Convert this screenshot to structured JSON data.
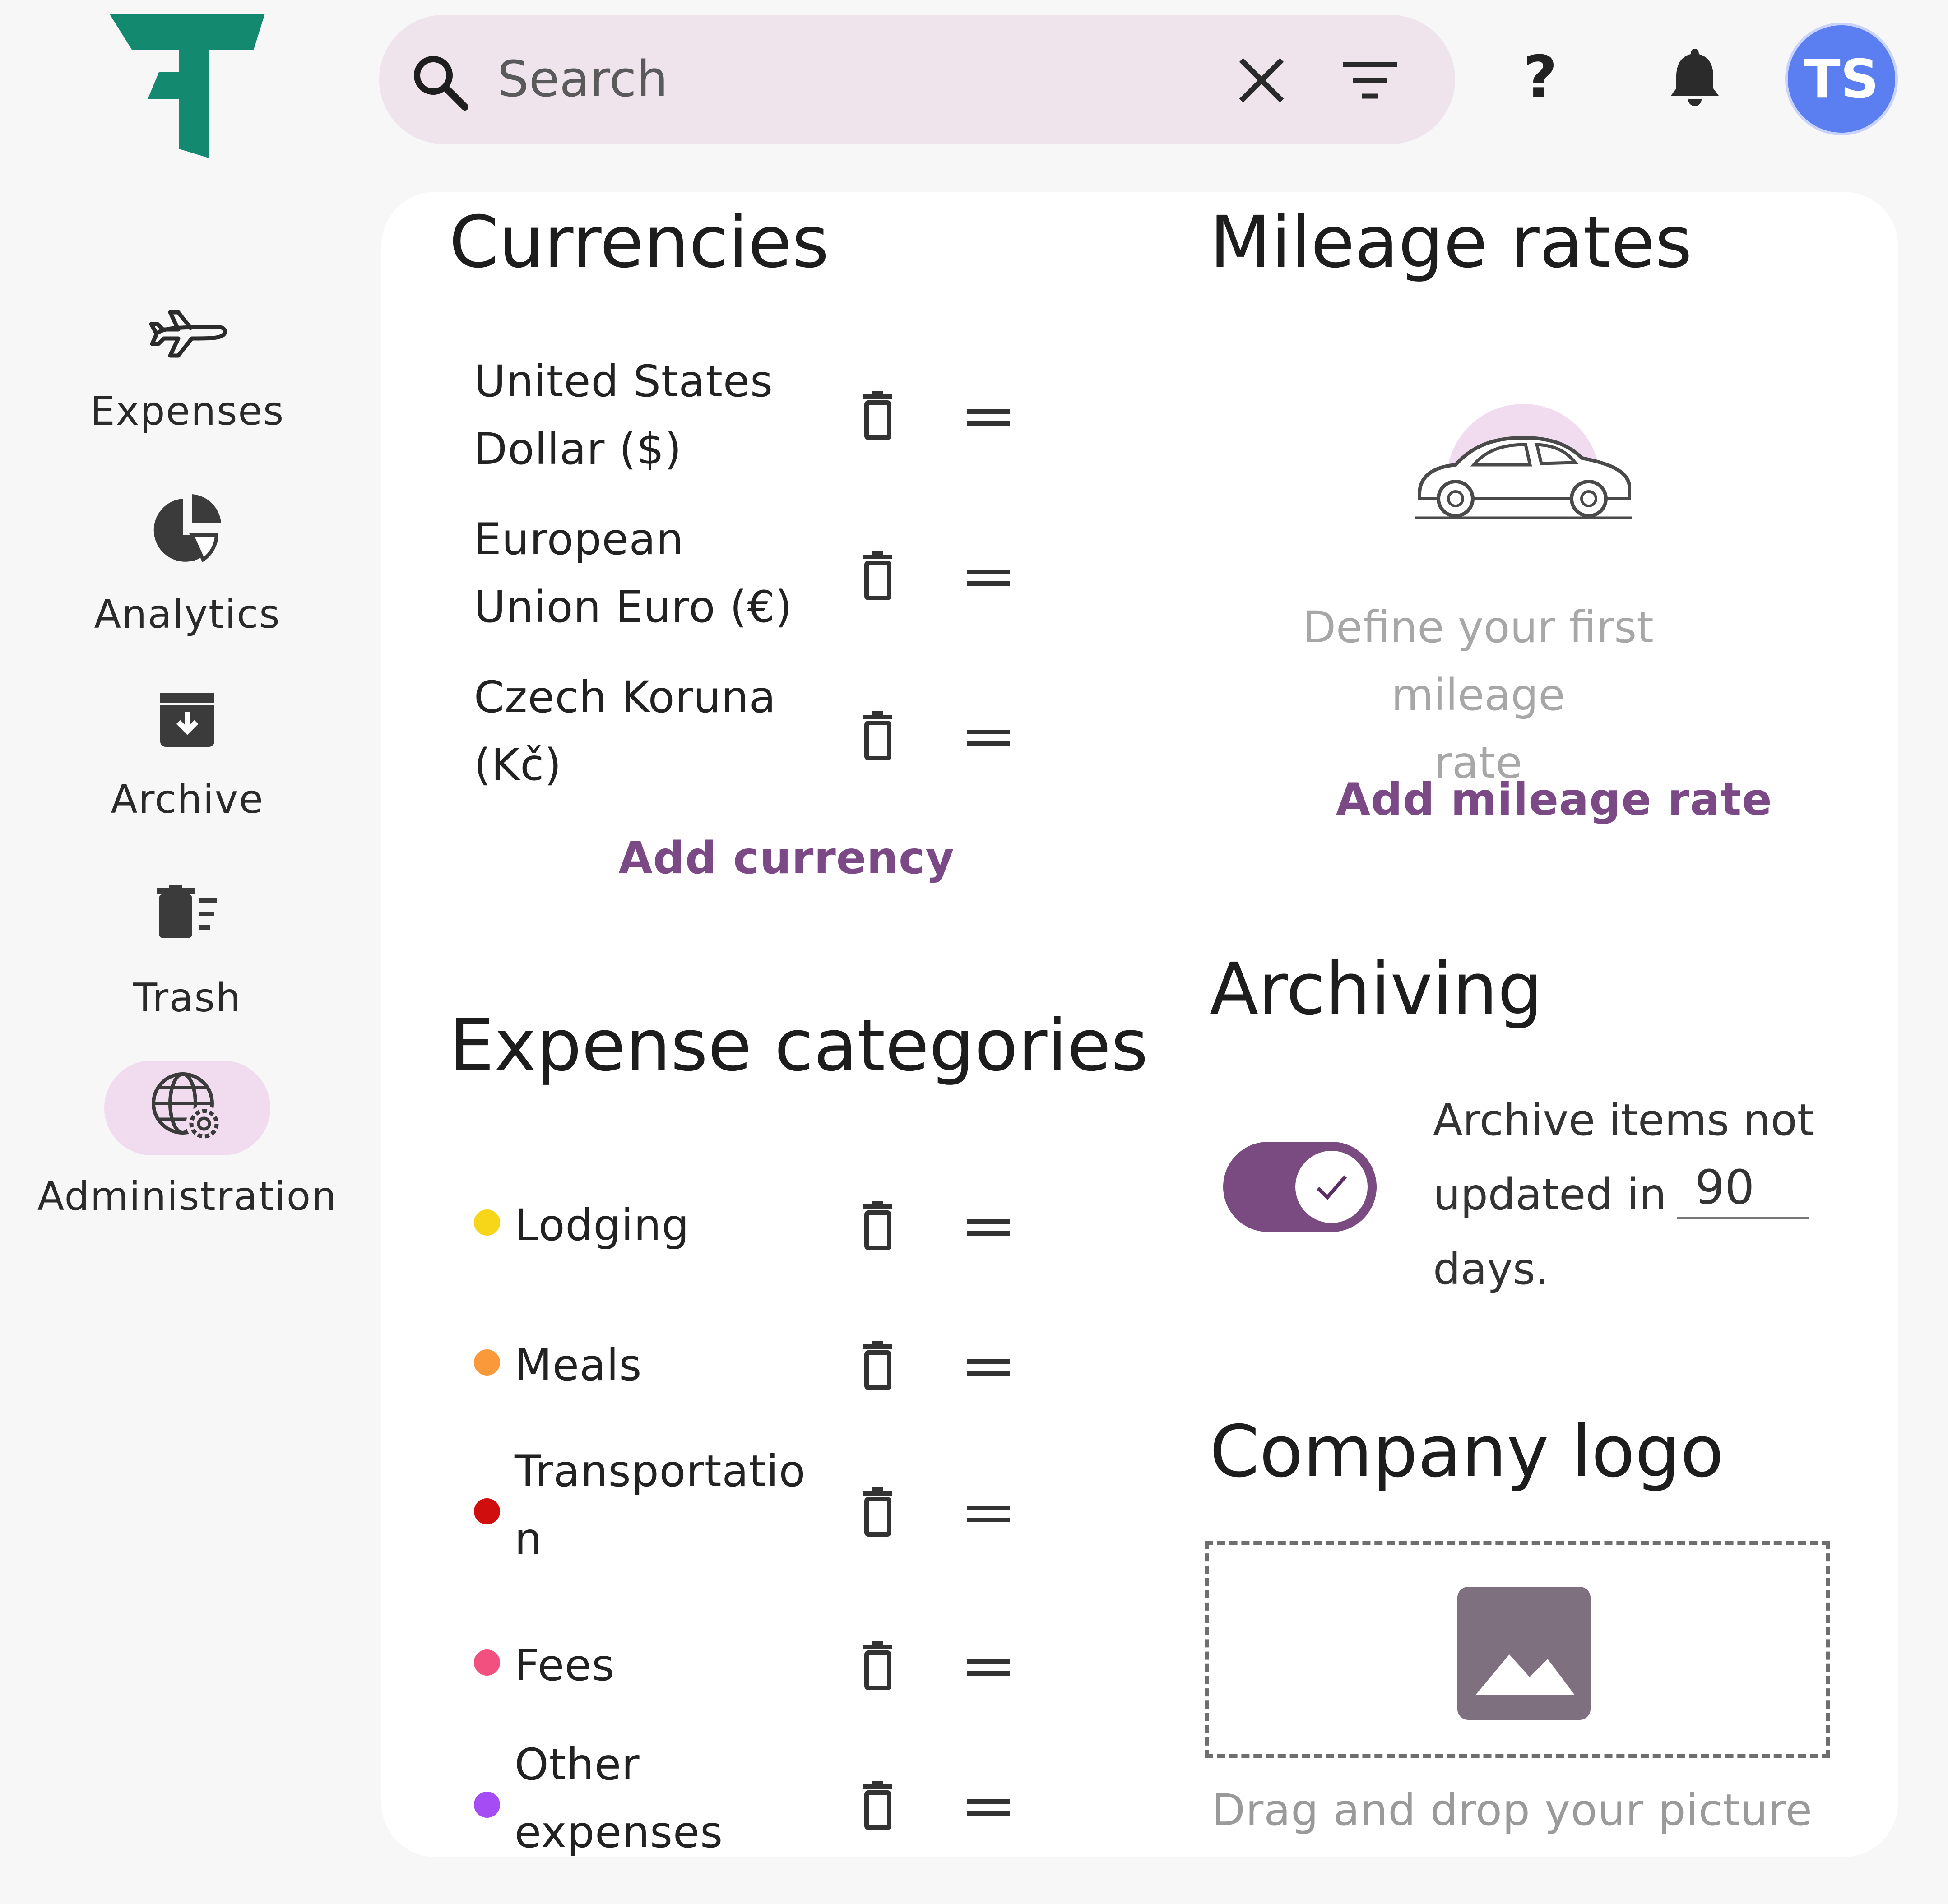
{
  "colors": {
    "brand": "#13896f",
    "accent": "#7b4a86",
    "search_bg": "#efe3ec",
    "avatar_bg": "#5b7ff0",
    "active_nav_bg": "#f1dcef"
  },
  "sidebar": {
    "logo_icon": "brand-logo-icon",
    "items": [
      {
        "label": "Expenses",
        "icon": "airplane-icon",
        "active": false
      },
      {
        "label": "Analytics",
        "icon": "pie-chart-icon",
        "active": false
      },
      {
        "label": "Archive",
        "icon": "archive-box-icon",
        "active": false
      },
      {
        "label": "Trash",
        "icon": "trash-list-icon",
        "active": false
      },
      {
        "label": "Administration",
        "icon": "globe-gear-icon",
        "active": true
      }
    ]
  },
  "topbar": {
    "search_placeholder": "Search",
    "search_value": "",
    "clear_icon": "close-icon",
    "filter_icon": "filter-icon",
    "help_label": "?",
    "bell_icon": "bell-icon",
    "avatar_initials": "TS"
  },
  "currencies": {
    "title": "Currencies",
    "items": [
      {
        "line1": "United States",
        "line2": "Dollar ($)"
      },
      {
        "line1": "European",
        "line2": "Union Euro (€)"
      },
      {
        "line1": "Czech Koruna",
        "line2": "(Kč)"
      }
    ],
    "add_label": "Add currency"
  },
  "categories": {
    "title": "Expense categories",
    "items": [
      {
        "line1": "Lodging",
        "line2": "",
        "color": "#f7d518"
      },
      {
        "line1": "Meals",
        "line2": "",
        "color": "#f9993a"
      },
      {
        "line1": "Transportatio",
        "line2": "n",
        "color": "#d10e0e"
      },
      {
        "line1": "Fees",
        "line2": "",
        "color": "#f2507e"
      },
      {
        "line1": "Other",
        "line2": "expenses",
        "color": "#a64cf5"
      }
    ]
  },
  "mileage": {
    "title": "Mileage rates",
    "illustration_icon": "car-icon",
    "empty_line1": "Define your first mileage",
    "empty_line2": "rate",
    "add_label": "Add mileage rate"
  },
  "archiving": {
    "title": "Archiving",
    "enabled": true,
    "text_line1": "Archive items not",
    "text_line2": "updated in",
    "days_value": "90",
    "text_line3": "days."
  },
  "company_logo": {
    "title": "Company logo",
    "placeholder_icon": "image-icon",
    "hint": "Drag and drop your picture"
  }
}
